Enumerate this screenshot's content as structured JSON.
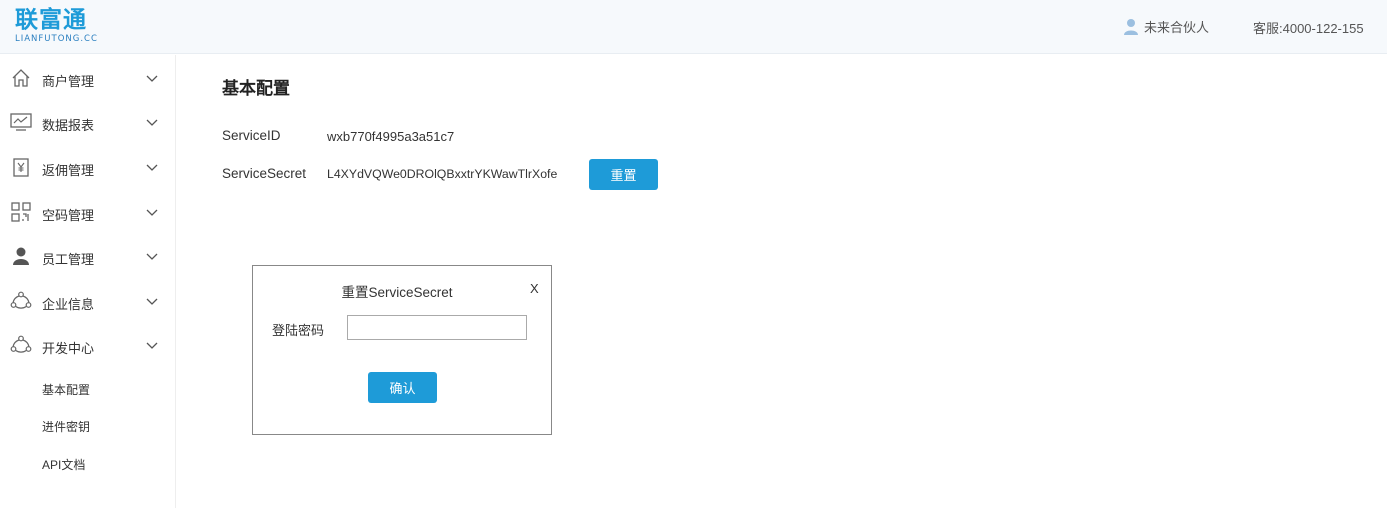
{
  "header": {
    "logo_text": "联富通",
    "logo_subtext": "LIANFUTONG.CC",
    "user_name": "未来合伙人",
    "service_phone": "客服:4000-122-155"
  },
  "sidebar": {
    "items": [
      {
        "label": "商户管理",
        "icon": "home-icon"
      },
      {
        "label": "数据报表",
        "icon": "chart-monitor-icon"
      },
      {
        "label": "返佣管理",
        "icon": "yen-document-icon"
      },
      {
        "label": "空码管理",
        "icon": "qr-code-icon"
      },
      {
        "label": "员工管理",
        "icon": "person-icon"
      },
      {
        "label": "企业信息",
        "icon": "network-icon"
      },
      {
        "label": "开发中心",
        "icon": "network-icon"
      }
    ],
    "subitems": [
      {
        "label": "基本配置"
      },
      {
        "label": "进件密钥"
      },
      {
        "label": "API文档"
      }
    ]
  },
  "main": {
    "title": "基本配置",
    "service_id_label": "ServiceID",
    "service_id_value": "wxb770f4995a3a51c7",
    "service_secret_label": "ServiceSecret",
    "service_secret_value": "L4XYdVQWe0DROlQBxxtrYKWawTlrXofe",
    "reset_button": "重置"
  },
  "modal": {
    "title": "重置ServiceSecret",
    "close": "X",
    "password_label": "登陆密码",
    "password_value": "",
    "confirm_button": "确认"
  },
  "colors": {
    "accent": "#1e9bd8",
    "header_bg": "#f6f9fc"
  }
}
